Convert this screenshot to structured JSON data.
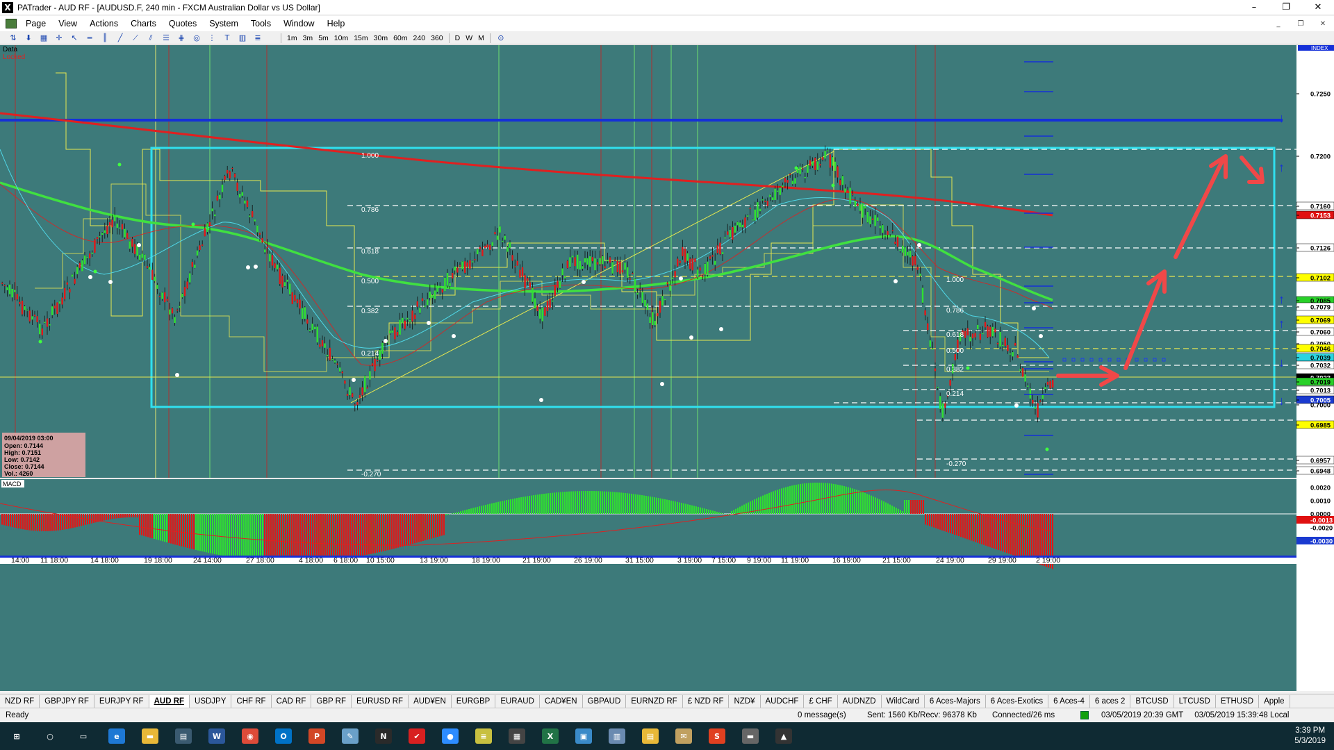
{
  "window": {
    "app_glyph": "X",
    "title": "PATrader - AUD RF - [AUDUSD.F, 240 min - FXCM Australian Dollar vs US Dollar]",
    "controls": {
      "minimize": "–",
      "maximize": "❐",
      "close": "✕"
    },
    "mdi_controls": {
      "minimize": "_",
      "restore": "❐",
      "close": "✕"
    }
  },
  "menu": {
    "items": [
      "Page",
      "View",
      "Actions",
      "Charts",
      "Quotes",
      "System",
      "Tools",
      "Window",
      "Help"
    ]
  },
  "toolbar": {
    "timeframes": [
      "1m",
      "3m",
      "5m",
      "10m",
      "15m",
      "30m",
      "60m",
      "240",
      "360"
    ],
    "periods": [
      "D",
      "W",
      "M"
    ],
    "icons": [
      "up-down-arrows-icon",
      "down-arrow-icon",
      "chart-icon",
      "crosshair-icon",
      "pointer-icon",
      "hline-icon",
      "vline-icon",
      "trendline-icon",
      "fib-fan-icon",
      "channel-icon",
      "fib-retracement-icon",
      "gann-icon",
      "cycle-icon",
      "fib-time-icon",
      "text-tool-icon",
      "profile-icon",
      "levels-icon",
      "clock-icon"
    ]
  },
  "chart": {
    "label_data": "Data",
    "label_locked": "Locked",
    "label_index": "INDEX",
    "label_macd": "MACD",
    "info_box": {
      "date": "09/04/2019 03:00",
      "lines": [
        "Open: 0.7144",
        "High: 0.7151",
        "Low: 0.7142",
        "Close: 0.7144",
        "Vol.: 4260"
      ]
    },
    "fib_left": [
      "1.000",
      "0.786",
      "0.618",
      "0.500",
      "0.382",
      "0.214",
      "-0.270"
    ],
    "fib_right": [
      "1.000",
      "0.786",
      "0.618",
      "0.500",
      "0.382",
      "0.214",
      "-0.270"
    ],
    "price_axis": [
      {
        "label": "0.7250"
      },
      {
        "label": "0.7200"
      },
      {
        "label": "0.7160",
        "bg": "#ffffff",
        "fg": "#000000"
      },
      {
        "label": "0.7153",
        "bg": "#e01010",
        "fg": "#ffffff"
      },
      {
        "label": "0.7126",
        "bg": "#ffffff",
        "fg": "#000000"
      },
      {
        "label": "0.7102",
        "bg": "#ffff00",
        "fg": "#000000"
      },
      {
        "label": "0.7085",
        "bg": "#28d028",
        "fg": "#000000"
      },
      {
        "label": "0.7079",
        "bg": "#ffffff",
        "fg": "#000000"
      },
      {
        "label": "0.7069",
        "bg": "#ffff00",
        "fg": "#000000"
      },
      {
        "label": "0.7060",
        "bg": "#ffffff",
        "fg": "#000000"
      },
      {
        "label": "0.7050"
      },
      {
        "label": "0.7046",
        "bg": "#ffff00",
        "fg": "#000000"
      },
      {
        "label": "0.7039",
        "bg": "#2bd4e0",
        "fg": "#000000"
      },
      {
        "label": "0.7032",
        "bg": "#ffffff",
        "fg": "#000000"
      },
      {
        "label": "0.7023",
        "bg": "#000000",
        "fg": "#ffffff"
      },
      {
        "label": "0.7019",
        "bg": "#28d028",
        "fg": "#000000"
      },
      {
        "label": "0.7013",
        "bg": "#ffffff",
        "fg": "#000000"
      },
      {
        "label": "0.7005",
        "bg": "#1a3ad0",
        "fg": "#ffffff"
      },
      {
        "label": "0.7000"
      },
      {
        "label": "0.6985",
        "bg": "#ffff00",
        "fg": "#000000"
      },
      {
        "label": "0.6957",
        "bg": "#ffffff",
        "fg": "#000000"
      },
      {
        "label": "0.6948",
        "bg": "#ffffff",
        "fg": "#000000"
      }
    ],
    "macd_axis": [
      {
        "label": "0.0020"
      },
      {
        "label": "0.0010"
      },
      {
        "label": "0.0000"
      },
      {
        "label": "-0.0013",
        "bg": "#e01010",
        "fg": "#ffffff"
      },
      {
        "label": "-0.0020"
      },
      {
        "label": "-0.0030",
        "bg": "#1a3ad0",
        "fg": "#ffffff"
      }
    ],
    "time_axis": [
      "14:00",
      "11 18:00",
      "14 18:00",
      "19 18:00",
      "24 14:00",
      "27 18:00",
      "4 18:00",
      "6 18:00",
      "10 15:00",
      "13 19:00",
      "18 19:00",
      "21 19:00",
      "26 19:00",
      "31 15:00",
      "3 19:00",
      "7 15:00",
      "9 19:00",
      "11 19:00",
      "16 19:00",
      "21 15:00",
      "24 19:00",
      "29 19:00",
      "2 19:00"
    ]
  },
  "tabs": [
    "NZD RF",
    "GBPJPY RF",
    "EURJPY RF",
    "AUD RF",
    "USDJPY",
    "CHF RF",
    "CAD RF",
    "GBP RF",
    "EURUSD RF",
    "AUD¥EN",
    "EURGBP",
    "EURAUD",
    "CAD¥EN",
    "GBPAUD",
    "EURNZD RF",
    "£ NZD RF",
    "NZD¥",
    "AUDCHF",
    "£ CHF",
    "AUDNZD",
    "WildCard",
    "6 Aces-Majors",
    "6 Aces-Exotics",
    "6 Aces-4",
    "6 aces 2",
    "BTCUSD",
    "LTCUSD",
    "ETHUSD",
    "Apple"
  ],
  "active_tab": "AUD RF",
  "status": {
    "ready": "Ready",
    "messages": "0 message(s)",
    "traffic": "Sent: 1560 Kb/Recv: 96378 Kb",
    "connection": "Connected/26 ms",
    "gmt_time": "03/05/2019 20:39 GMT",
    "local_time": "03/05/2019 15:39:48 Local"
  },
  "taskbar": {
    "icons": [
      {
        "name": "start-icon",
        "glyph": "⊞",
        "color": "#0f2a33"
      },
      {
        "name": "search-icon",
        "glyph": "○",
        "color": "#0f2a33"
      },
      {
        "name": "task-view-icon",
        "glyph": "▭",
        "color": "#0f2a33"
      },
      {
        "name": "edge-icon",
        "glyph": "e",
        "color": "#1e78d4"
      },
      {
        "name": "file-explorer-icon",
        "glyph": "▬",
        "color": "#e8b838"
      },
      {
        "name": "patrader-icon",
        "glyph": "▤",
        "color": "#3a5a70"
      },
      {
        "name": "word-icon",
        "glyph": "W",
        "color": "#2b579a"
      },
      {
        "name": "chrome-icon",
        "glyph": "◉",
        "color": "#dd4b39"
      },
      {
        "name": "outlook-icon",
        "glyph": "O",
        "color": "#0072c6"
      },
      {
        "name": "powerpoint-icon",
        "glyph": "P",
        "color": "#d24726"
      },
      {
        "name": "notes-icon",
        "glyph": "✎",
        "color": "#6aa0c8"
      },
      {
        "name": "ninjatrader-icon",
        "glyph": "N",
        "color": "#2a2a2a"
      },
      {
        "name": "app-red-icon",
        "glyph": "✔",
        "color": "#d82020"
      },
      {
        "name": "zoom-icon",
        "glyph": "●",
        "color": "#2d8cff"
      },
      {
        "name": "notepad-icon",
        "glyph": "≡",
        "color": "#c8c040"
      },
      {
        "name": "calculator-icon",
        "glyph": "▦",
        "color": "#444"
      },
      {
        "name": "excel-icon",
        "glyph": "X",
        "color": "#217346"
      },
      {
        "name": "remote-icon",
        "glyph": "▣",
        "color": "#3a8ac8"
      },
      {
        "name": "calendar-icon",
        "glyph": "▥",
        "color": "#6a8ab0"
      },
      {
        "name": "document-icon",
        "glyph": "▤",
        "color": "#e8b838"
      },
      {
        "name": "scroll-icon",
        "glyph": "✉",
        "color": "#c0a060"
      },
      {
        "name": "snagit-icon",
        "glyph": "S",
        "color": "#e04020"
      },
      {
        "name": "tablet-icon",
        "glyph": "▬",
        "color": "#666"
      },
      {
        "name": "photos-icon",
        "glyph": "▲",
        "color": "#333"
      }
    ],
    "time": "3:39 PM",
    "date": "5/3/2019"
  }
}
